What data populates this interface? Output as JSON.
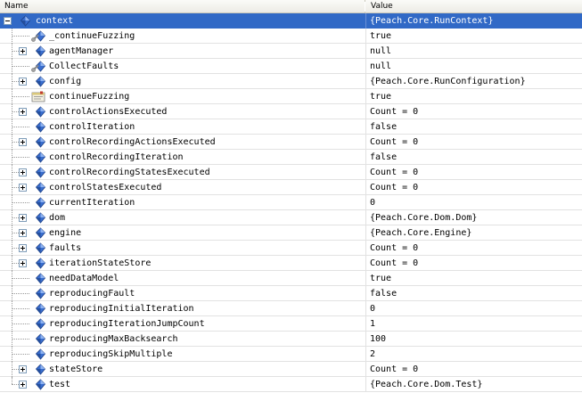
{
  "header": {
    "name_label": "Name",
    "value_label": "Value"
  },
  "rows": [
    {
      "name": "context",
      "value": "{Peach.Core.RunContext}",
      "icon": "field-icon",
      "expander": "minus",
      "root": true,
      "selected": true
    },
    {
      "name": "_continueFuzzing",
      "value": "true",
      "icon": "wrench-field-icon",
      "expander": "none"
    },
    {
      "name": "agentManager",
      "value": "null",
      "icon": "field-icon",
      "expander": "plus"
    },
    {
      "name": "CollectFaults",
      "value": "null",
      "icon": "wrench-field-icon",
      "expander": "none"
    },
    {
      "name": "config",
      "value": "{Peach.Core.RunConfiguration}",
      "icon": "field-icon",
      "expander": "plus"
    },
    {
      "name": "continueFuzzing",
      "value": "true",
      "icon": "property-icon",
      "expander": "none"
    },
    {
      "name": "controlActionsExecuted",
      "value": "Count = 0",
      "icon": "field-icon",
      "expander": "plus"
    },
    {
      "name": "controlIteration",
      "value": "false",
      "icon": "field-icon",
      "expander": "none"
    },
    {
      "name": "controlRecordingActionsExecuted",
      "value": "Count = 0",
      "icon": "field-icon",
      "expander": "plus"
    },
    {
      "name": "controlRecordingIteration",
      "value": "false",
      "icon": "field-icon",
      "expander": "none"
    },
    {
      "name": "controlRecordingStatesExecuted",
      "value": "Count = 0",
      "icon": "field-icon",
      "expander": "plus"
    },
    {
      "name": "controlStatesExecuted",
      "value": "Count = 0",
      "icon": "field-icon",
      "expander": "plus"
    },
    {
      "name": "currentIteration",
      "value": "0",
      "icon": "field-icon",
      "expander": "none"
    },
    {
      "name": "dom",
      "value": "{Peach.Core.Dom.Dom}",
      "icon": "field-icon",
      "expander": "plus"
    },
    {
      "name": "engine",
      "value": "{Peach.Core.Engine}",
      "icon": "field-icon",
      "expander": "plus"
    },
    {
      "name": "faults",
      "value": "Count = 0",
      "icon": "field-icon",
      "expander": "plus"
    },
    {
      "name": "iterationStateStore",
      "value": "Count = 0",
      "icon": "field-icon",
      "expander": "plus"
    },
    {
      "name": "needDataModel",
      "value": "true",
      "icon": "field-icon",
      "expander": "none"
    },
    {
      "name": "reproducingFault",
      "value": "false",
      "icon": "field-icon",
      "expander": "none"
    },
    {
      "name": "reproducingInitialIteration",
      "value": "0",
      "icon": "field-icon",
      "expander": "none"
    },
    {
      "name": "reproducingIterationJumpCount",
      "value": "1",
      "icon": "field-icon",
      "expander": "none"
    },
    {
      "name": "reproducingMaxBacksearch",
      "value": "100",
      "icon": "field-icon",
      "expander": "none"
    },
    {
      "name": "reproducingSkipMultiple",
      "value": "2",
      "icon": "field-icon",
      "expander": "none"
    },
    {
      "name": "stateStore",
      "value": "Count = 0",
      "icon": "field-icon",
      "expander": "plus"
    },
    {
      "name": "test",
      "value": "{Peach.Core.Dom.Test}",
      "icon": "field-icon",
      "expander": "plus"
    }
  ],
  "colors": {
    "selection": "#3169c6",
    "grid": "#e2e2e2",
    "icon_blue": "#2f5fb3"
  }
}
